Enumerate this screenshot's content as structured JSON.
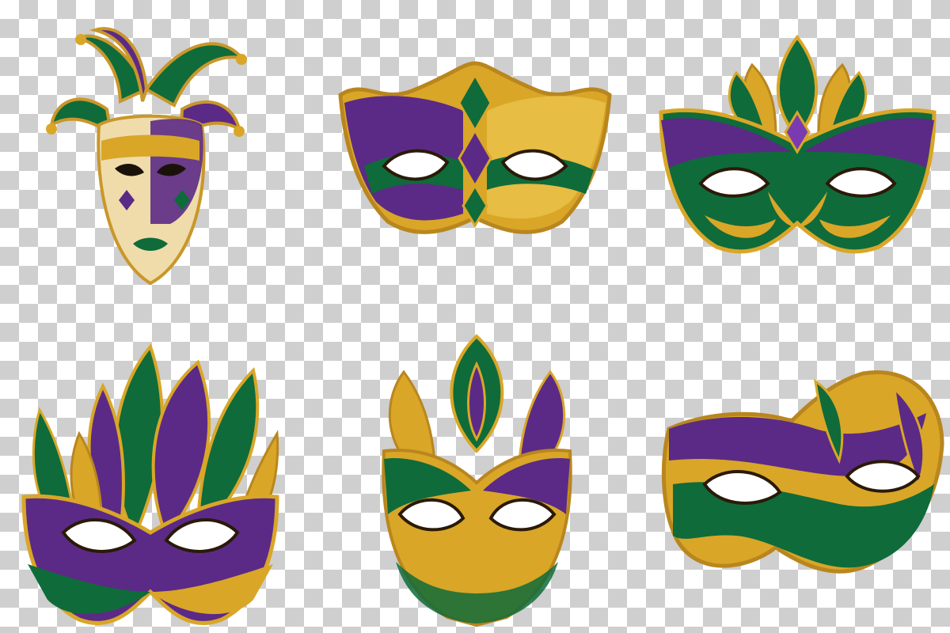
{
  "palette": {
    "purple": "#5b2a86",
    "green": "#0f6b3a",
    "gold": "#d9a628",
    "gold_light": "#f1cd5d",
    "outline": "#2a1a08",
    "checker_light": "#ffffff",
    "checker_dark": "#cfcfcf"
  },
  "masks": [
    {
      "name": "jester-face-mask",
      "colors": [
        "purple",
        "green",
        "gold"
      ]
    },
    {
      "name": "harlequin-eye-mask",
      "colors": [
        "purple",
        "green",
        "gold"
      ]
    },
    {
      "name": "leaf-crown-eye-mask",
      "colors": [
        "purple",
        "green",
        "gold"
      ]
    },
    {
      "name": "feather-swirl-mask",
      "colors": [
        "purple",
        "green",
        "gold"
      ]
    },
    {
      "name": "fleur-de-lis-face-mask",
      "colors": [
        "purple",
        "green",
        "gold"
      ]
    },
    {
      "name": "ribbon-wave-eye-mask",
      "colors": [
        "purple",
        "green",
        "gold"
      ]
    }
  ]
}
